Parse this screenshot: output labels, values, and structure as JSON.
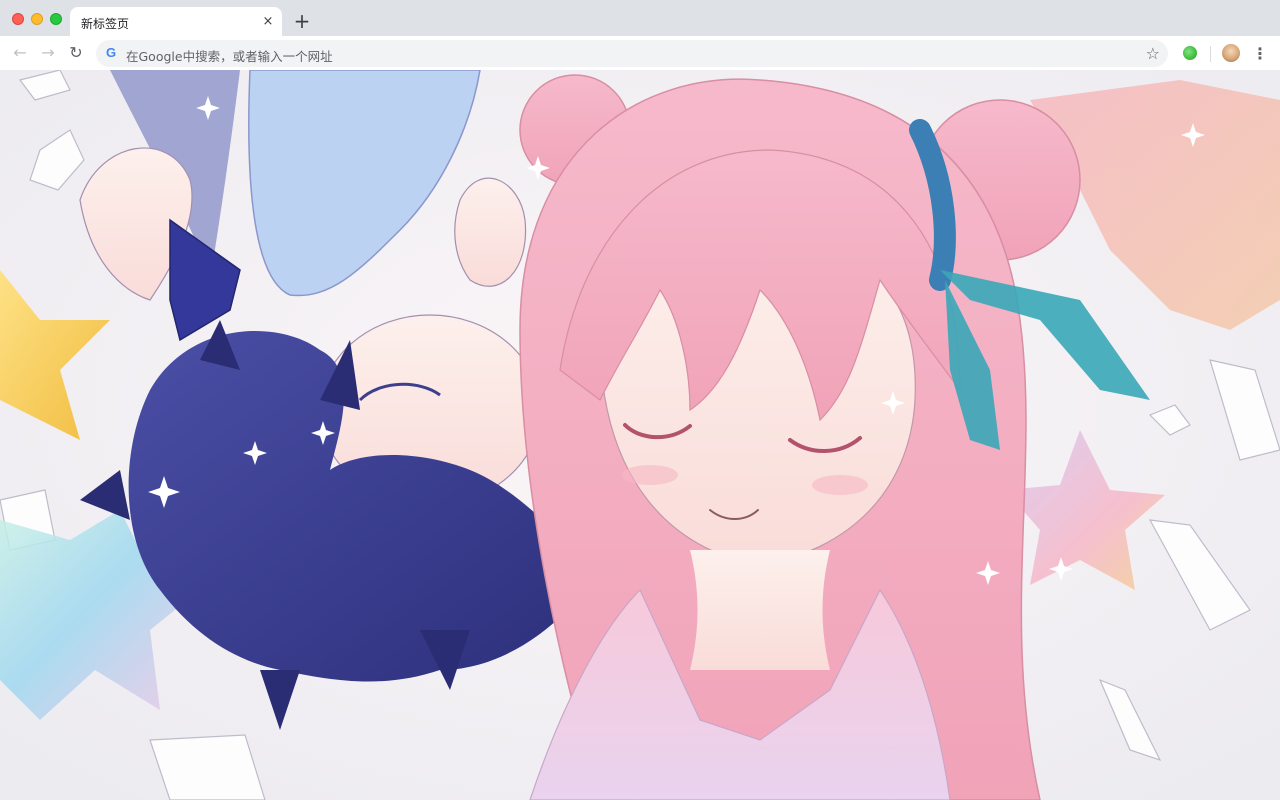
{
  "window": {
    "controls": [
      "close",
      "minimize",
      "maximize"
    ]
  },
  "tab": {
    "title": "新标签页",
    "close_icon": "×"
  },
  "new_tab_icon": "+",
  "toolbar": {
    "back_icon": "←",
    "forward_icon": "→",
    "reload_icon": "↻",
    "google_logo": "G",
    "omnibox_placeholder": "在Google中搜索，或者输入一个网址",
    "bookmark_icon": "☆",
    "menu_icon": "⋮"
  },
  "wallpaper": {
    "description_icon": "anime-wallpaper-icon",
    "palette": {
      "pink_hair": "#f4b3c6",
      "navy_hair": "#3a3e8f",
      "teal_ribbon": "#3aa7b7",
      "star_yellow": "#f2c23a",
      "background": "#f3f1f4"
    }
  }
}
